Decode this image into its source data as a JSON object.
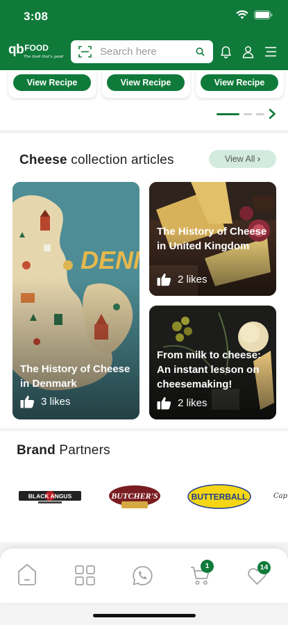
{
  "status_bar": {
    "time": "3:08"
  },
  "header": {
    "logo_text": "qb",
    "logo_food": "FOOD",
    "logo_tagline": "The food that's good",
    "search_placeholder": "Search here"
  },
  "recipes": {
    "button_label": "View Recipe"
  },
  "articles": {
    "title_bold": "Cheese",
    "title_rest": " collection articles",
    "view_all": "View All",
    "denmark_map_text": "DENMA",
    "items": [
      {
        "title": "The History of Cheese in Denmark",
        "likes": "3 likes"
      },
      {
        "title": "The History of Cheese in United Kingdom",
        "likes": "2 likes"
      },
      {
        "title": "From milk to cheese: An instant lesson on cheesemaking!",
        "likes": "2 likes"
      }
    ]
  },
  "brands": {
    "title_bold": "Brand",
    "title_rest": " Partners",
    "logos": [
      "BLACK ANGUS",
      "BUTCHER'S",
      "BUTTERBALL",
      "Cap"
    ]
  },
  "bottom_nav": {
    "cart_badge": "1",
    "wishlist_badge": "14"
  },
  "colors": {
    "brand_green": "#0f7a3a",
    "view_all_bg": "#d3ebde"
  }
}
